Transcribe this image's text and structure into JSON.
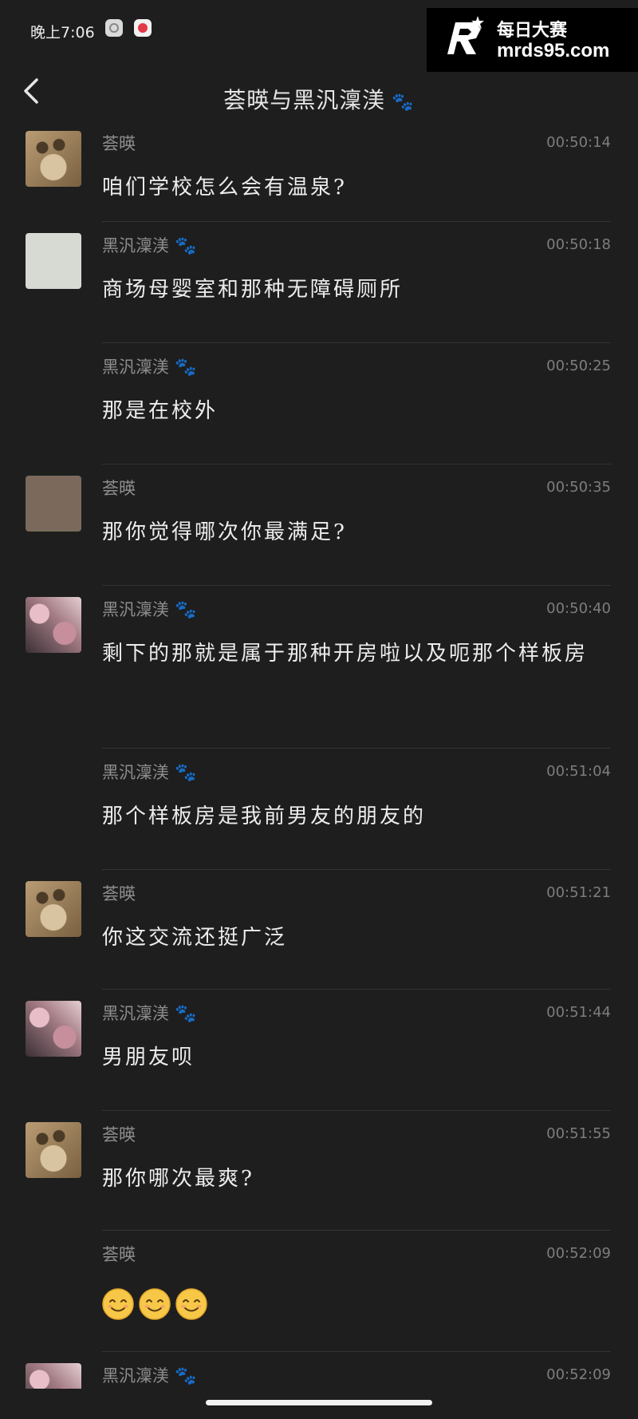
{
  "status_bar": {
    "time": "晚上7:06"
  },
  "watermark": {
    "brand": "每日大赛",
    "url": "mrds95.com"
  },
  "header": {
    "title": "荟暎与黑汎澟渼"
  },
  "messages": [
    {
      "sender": "荟暎",
      "time": "00:50:14",
      "text": "咱们学校怎么会有温泉?"
    },
    {
      "sender": "黑汎澟渼",
      "time": "00:50:18",
      "text": "商场母婴室和那种无障碍厕所"
    },
    {
      "sender": "黑汎澟渼",
      "time": "00:50:25",
      "text": "那是在校外"
    },
    {
      "sender": "荟暎",
      "time": "00:50:35",
      "text": "那你觉得哪次你最满足?"
    },
    {
      "sender": "黑汎澟渼",
      "time": "00:50:40",
      "text": "剩下的那就是属于那种开房啦以及呃那个样板房"
    },
    {
      "sender": "黑汎澟渼",
      "time": "00:51:04",
      "text": "那个样板房是我前男友的朋友的"
    },
    {
      "sender": "荟暎",
      "time": "00:51:21",
      "text": "你这交流还挺广泛"
    },
    {
      "sender": "黑汎澟渼",
      "time": "00:51:44",
      "text": "男朋友呗"
    },
    {
      "sender": "荟暎",
      "time": "00:51:55",
      "text": "那你哪次最爽?"
    },
    {
      "sender": "荟暎",
      "time": "00:52:09",
      "text": ""
    },
    {
      "sender": "黑汎澟渼",
      "time": "00:52:09",
      "text": ""
    }
  ],
  "icons": {
    "back": "chevron-left-icon",
    "paw": "paw-icon",
    "emoji": "smiling-face-emoji"
  },
  "colors": {
    "background": "#1e1e1e",
    "text": "#ededed",
    "muted": "#8e8e8e"
  }
}
